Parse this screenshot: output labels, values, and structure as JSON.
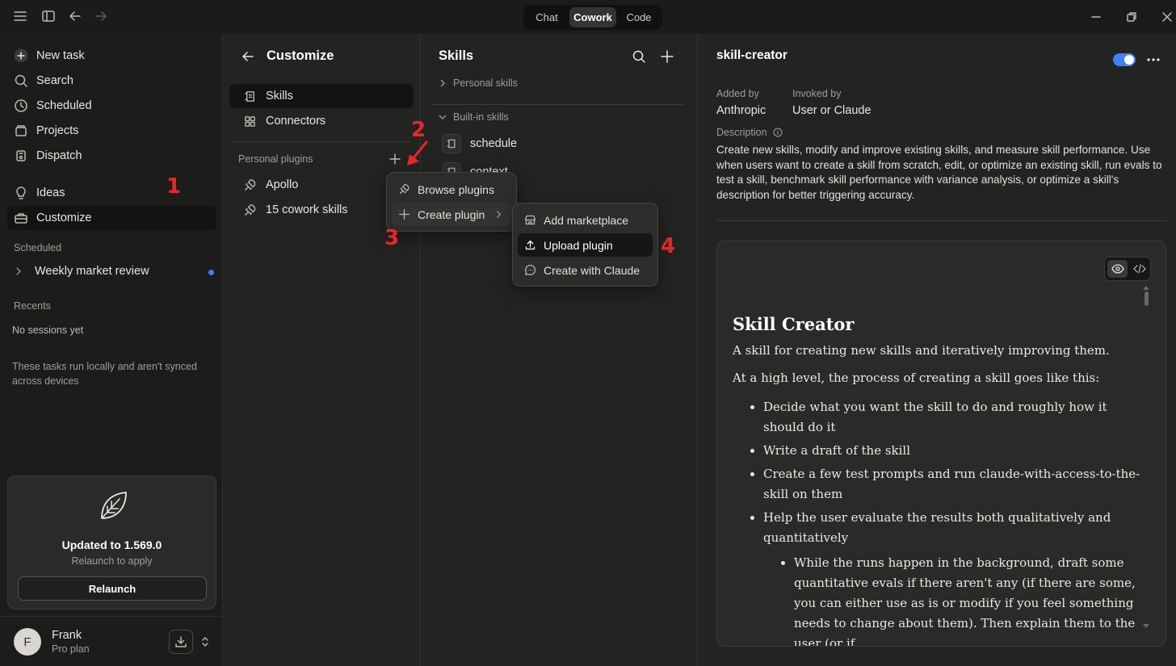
{
  "titlebar": {
    "modes": [
      "Chat",
      "Cowork",
      "Code"
    ],
    "active_mode": "Cowork"
  },
  "sidebar": {
    "nav": [
      {
        "label": "New task",
        "icon": "plus-circle-icon"
      },
      {
        "label": "Search",
        "icon": "search-icon"
      },
      {
        "label": "Scheduled",
        "icon": "clock-icon"
      },
      {
        "label": "Projects",
        "icon": "folder-icon"
      },
      {
        "label": "Dispatch",
        "icon": "dispatch-icon"
      }
    ],
    "nav2": [
      {
        "label": "Ideas",
        "icon": "lightbulb-icon"
      },
      {
        "label": "Customize",
        "icon": "briefcase-icon"
      }
    ],
    "scheduled_label": "Scheduled",
    "scheduled_item": "Weekly market review",
    "recents_label": "Recents",
    "no_sessions": "No sessions yet",
    "local_note": "These tasks run locally and aren't synced across devices",
    "update": {
      "title": "Updated to 1.569.0",
      "subtitle": "Relaunch to apply",
      "button": "Relaunch"
    },
    "user": {
      "initial": "F",
      "name": "Frank",
      "plan": "Pro plan"
    }
  },
  "customize": {
    "title": "Customize",
    "items": [
      "Skills",
      "Connectors"
    ],
    "plugins_label": "Personal plugins",
    "plugins": [
      "Apollo",
      "15 cowork skills"
    ]
  },
  "plugin_menu": {
    "items": [
      "Browse plugins",
      "Create plugin"
    ]
  },
  "create_submenu": {
    "items": [
      "Add marketplace",
      "Upload plugin",
      "Create with Claude"
    ]
  },
  "skills": {
    "title": "Skills",
    "personal_label": "Personal skills",
    "builtin_label": "Built-in skills",
    "builtin": [
      "schedule",
      "context"
    ]
  },
  "detail": {
    "title": "skill-creator",
    "added_by_label": "Added by",
    "added_by": "Anthropic",
    "invoked_by_label": "Invoked by",
    "invoked_by": "User or Claude",
    "description_label": "Description",
    "description": "Create new skills, modify and improve existing skills, and measure skill performance. Use when users want to create a skill from scratch, edit, or optimize an existing skill, run evals to test a skill, benchmark skill performance with variance analysis, or optimize a skill's description for better triggering accuracy.",
    "enabled": true,
    "preview": {
      "heading": "Skill Creator",
      "intro": "A skill for creating new skills and iteratively improving them.",
      "lead": "At a high level, the process of creating a skill goes like this:",
      "bullets": [
        "Decide what you want the skill to do and roughly how it should do it",
        "Write a draft of the skill",
        "Create a few test prompts and run claude-with-access-to-the-skill on them",
        "Help the user evaluate the results both qualitatively and quantitatively"
      ],
      "sub_bullet": "While the runs happen in the background, draft some quantitative evals if there aren't any (if there are some, you can either use as is or modify if you feel something needs to change about them). Then explain them to the user (or if"
    }
  },
  "annotations": [
    "1",
    "2",
    "3",
    "4"
  ],
  "colors": {
    "annotation": "#e8262b",
    "toggle": "#3b82f6",
    "dot": "#3b82f6"
  }
}
